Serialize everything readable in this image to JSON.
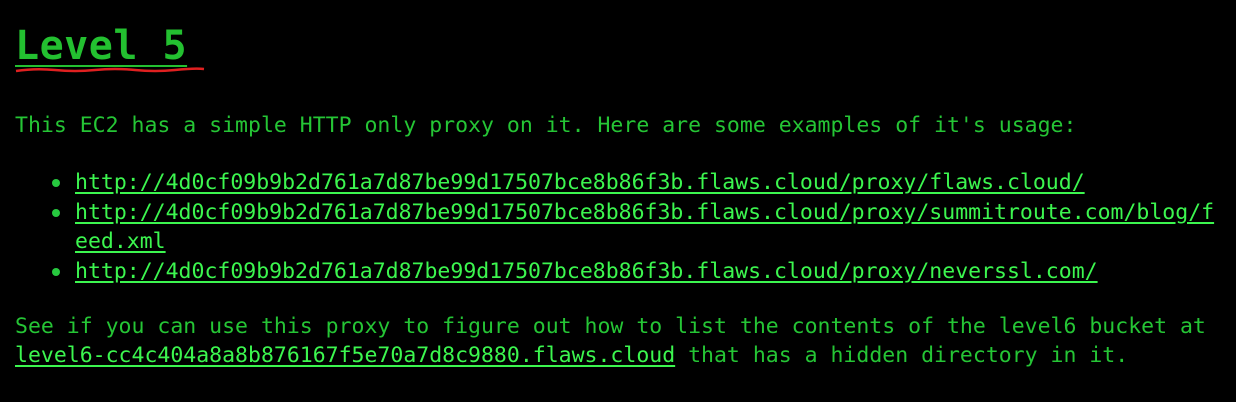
{
  "heading": "Level 5",
  "intro": "This EC2 has a simple HTTP only proxy on it. Here are some examples of it's usage:",
  "examples": [
    "http://4d0cf09b9b2d761a7d87be99d17507bce8b86f3b.flaws.cloud/proxy/flaws.cloud/",
    "http://4d0cf09b9b2d761a7d87be99d17507bce8b86f3b.flaws.cloud/proxy/summitroute.com/blog/feed.xml",
    "http://4d0cf09b9b2d761a7d87be99d17507bce8b86f3b.flaws.cloud/proxy/neverssl.com/"
  ],
  "outro": {
    "before": "See if you can use this proxy to figure out how to list the contents of the level6 bucket at ",
    "link": "level6-cc4c404a8a8b876167f5e70a7d8c9880.flaws.cloud",
    "after": " that has a hidden directory in it."
  },
  "colors": {
    "background": "#000000",
    "text": "#25c535",
    "link": "#3cf64f",
    "spellcheck": "#e02020"
  }
}
